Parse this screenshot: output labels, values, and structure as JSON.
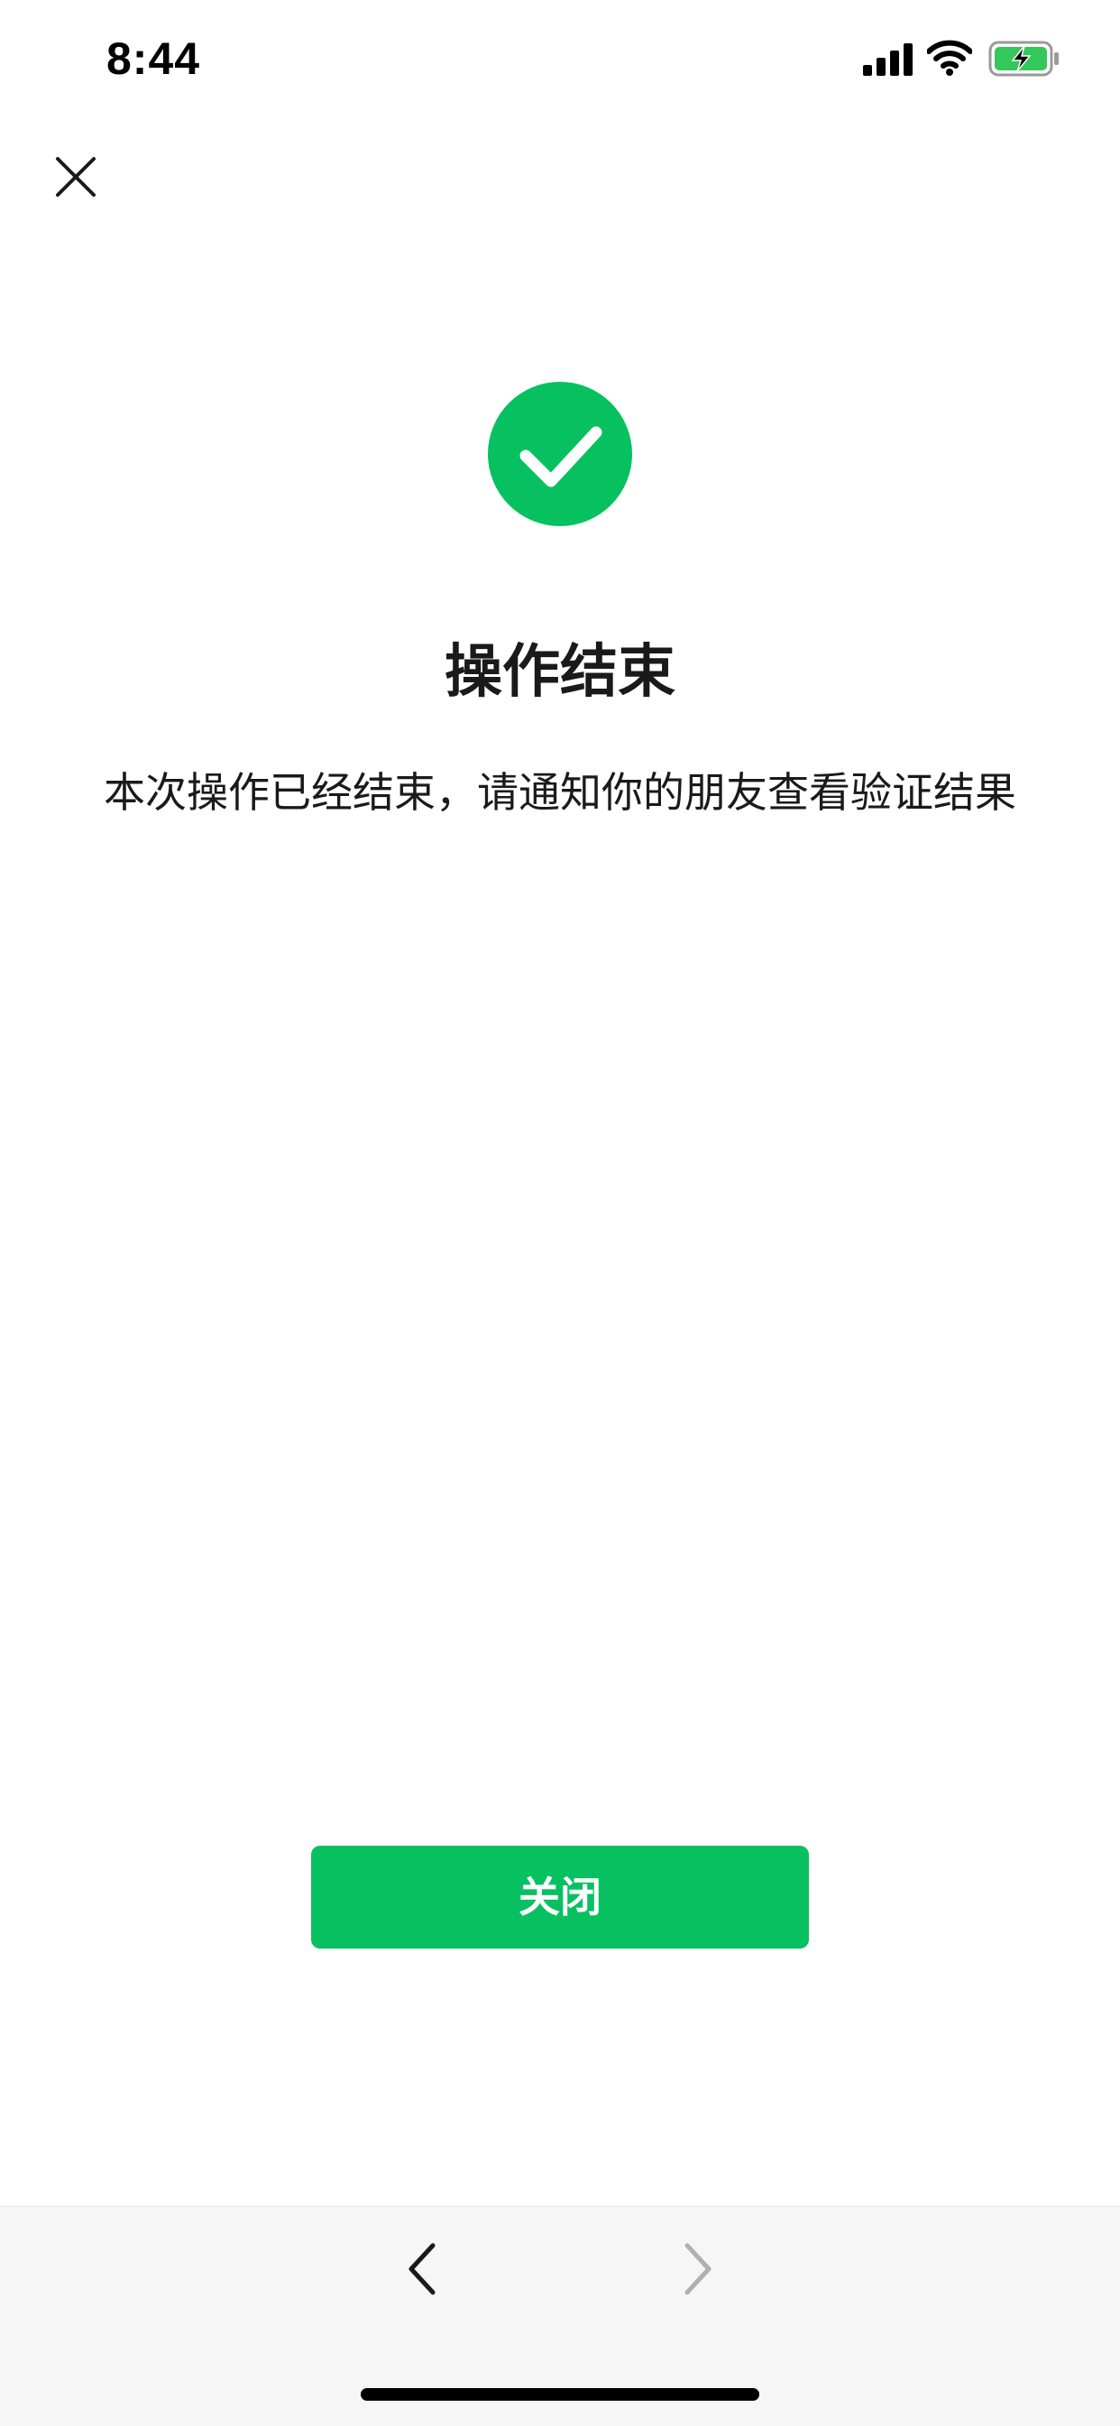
{
  "status_bar": {
    "time": "8:44",
    "icons": [
      "signal-icon",
      "wifi-icon",
      "battery-charging-icon"
    ],
    "battery_color": "#34c759"
  },
  "top_bar": {
    "close_icon": "close-icon"
  },
  "result": {
    "icon": "success-check-icon",
    "icon_color": "#07c160",
    "title": "操作结束",
    "description": "本次操作已经结束，请通知你的朋友查看验证结果"
  },
  "actions": {
    "close_label": "关闭",
    "button_color": "#07c160"
  },
  "bottom_nav": {
    "back_icon": "chevron-left-icon",
    "forward_icon": "chevron-right-icon"
  }
}
